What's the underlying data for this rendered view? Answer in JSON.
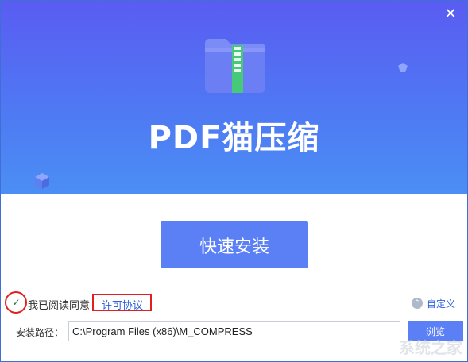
{
  "window": {
    "close_glyph": "✕"
  },
  "hero": {
    "app_name": "PDF猫压缩",
    "logo_icon": "zip-folder-icon",
    "colors": {
      "top": "#5a5cf2",
      "bottom": "#4b8ef4"
    }
  },
  "install": {
    "button_label": "快速安装"
  },
  "agreement": {
    "checked": true,
    "check_glyph": "✓",
    "text": "我已阅读同意",
    "link_label": "许可协议"
  },
  "custom": {
    "label": "自定义",
    "icon": "chevron-up-circle-icon",
    "icon_glyph": "⌃"
  },
  "path": {
    "label": "安装路径：",
    "value": "C:\\Program Files (x86)\\M_COMPRESS",
    "browse_label": "浏览"
  },
  "watermark": {
    "text": "系统之家"
  },
  "accent_color": "#5b80f6",
  "highlight_color": "#e02020"
}
